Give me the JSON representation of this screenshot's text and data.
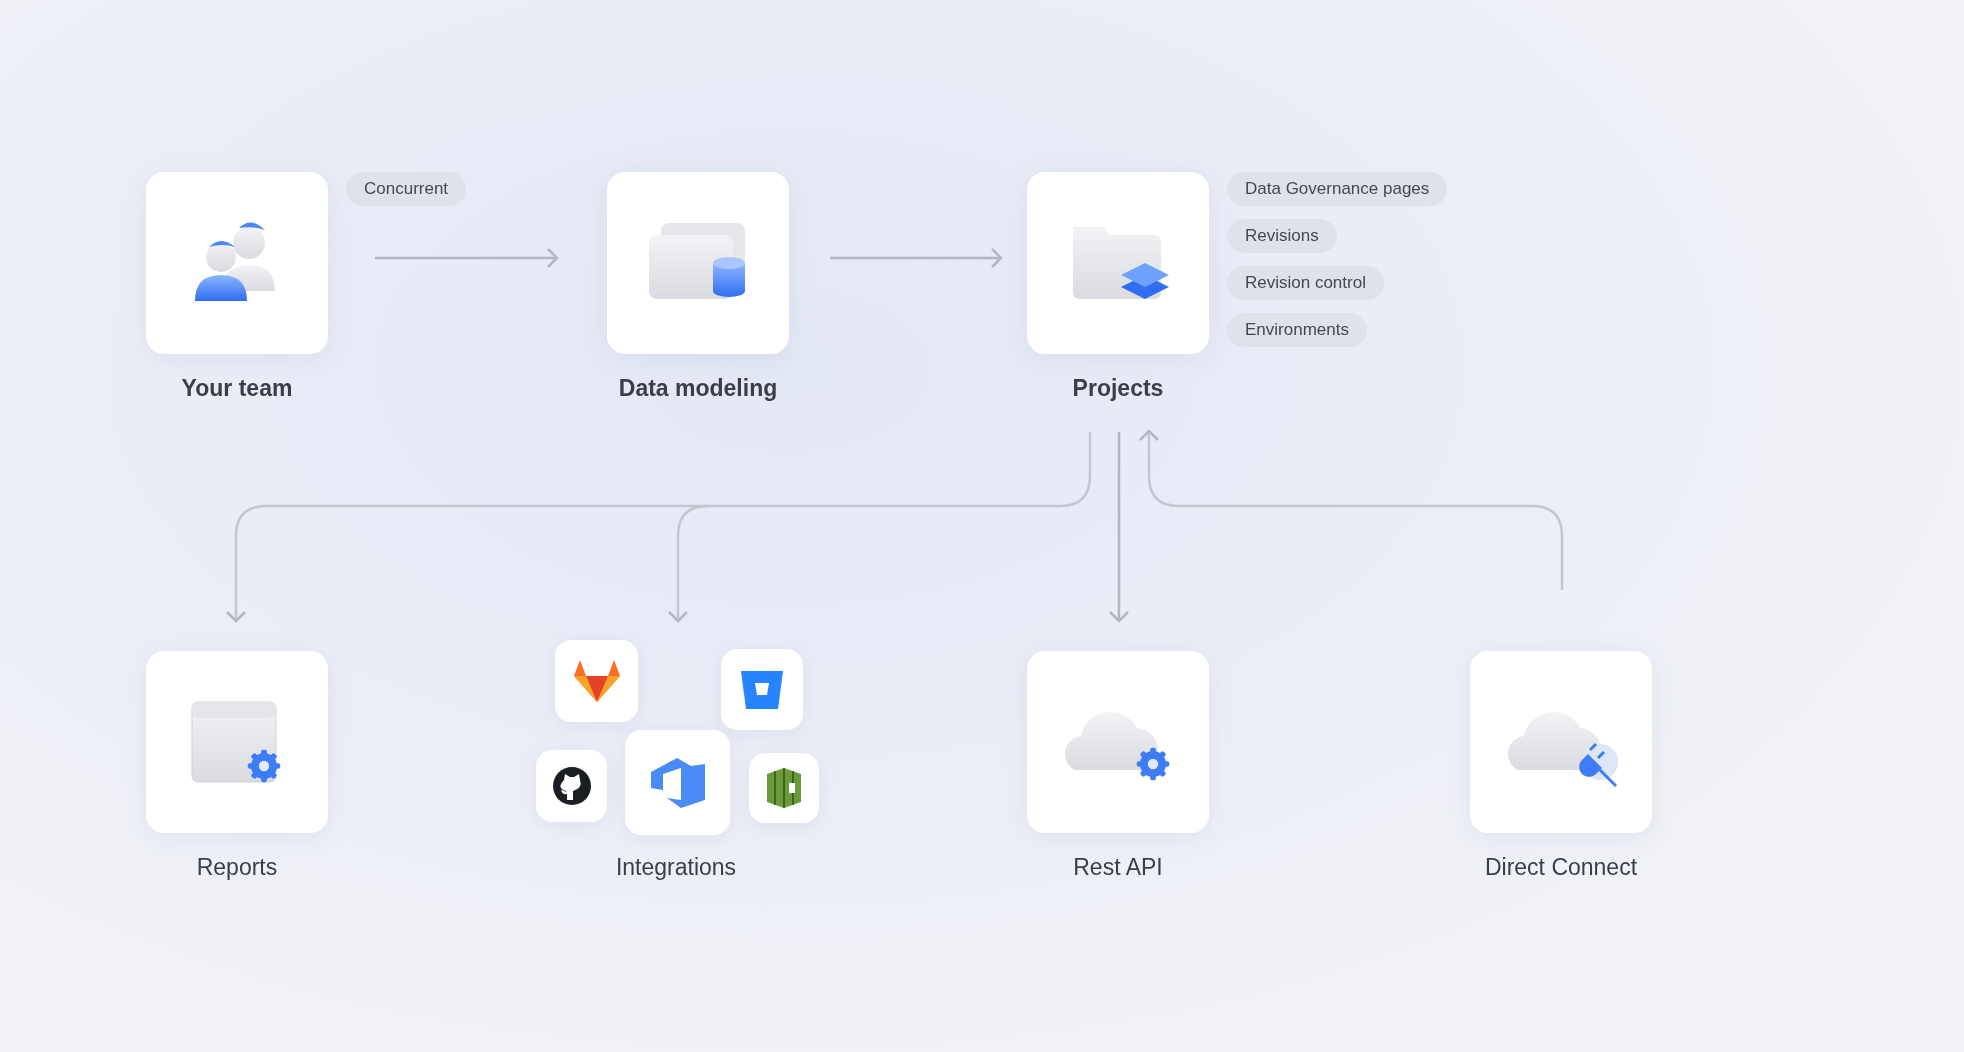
{
  "nodes": [
    {
      "kind": "team",
      "label": "Your team",
      "primary": true,
      "tags": [
        "Concurrent"
      ]
    },
    {
      "kind": "modeling",
      "label": "Data modeling",
      "primary": true
    },
    {
      "kind": "projects",
      "label": "Projects",
      "primary": true,
      "tags": [
        "Data Governance pages",
        "Revisions",
        "Revision control",
        "Environments"
      ]
    },
    {
      "kind": "reports",
      "label": "Reports",
      "primary": false
    },
    {
      "kind": "integrations",
      "label": "Integrations",
      "primary": false
    },
    {
      "kind": "api",
      "label": "Rest API",
      "primary": false
    },
    {
      "kind": "connect",
      "label": "Direct Connect",
      "primary": false
    }
  ]
}
